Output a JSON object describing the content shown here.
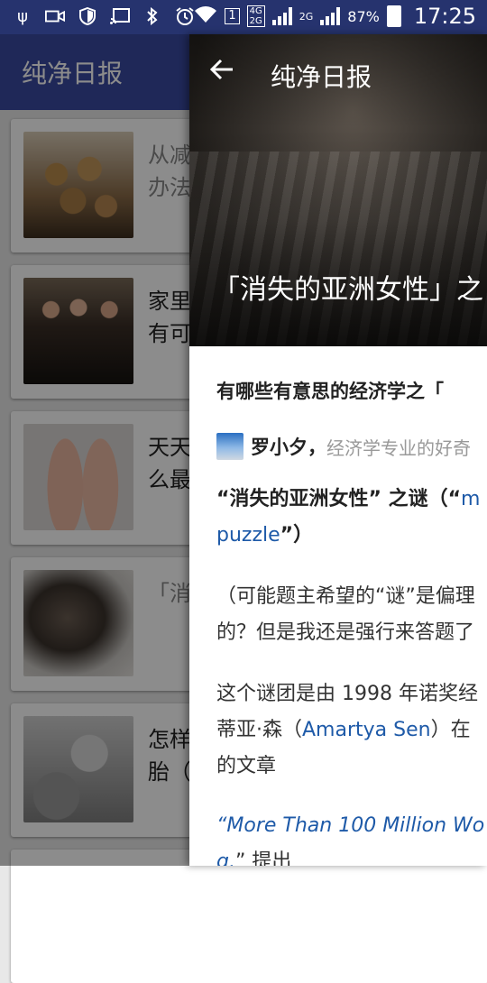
{
  "status_bar": {
    "sim_label": "1",
    "net_4g": "4G",
    "net_2g_a": "2G",
    "net_2g_b": "2G",
    "battery": "87%",
    "time": "17:25"
  },
  "app": {
    "title": "纯净日报"
  },
  "list": {
    "items": [
      {
        "title": "从减\n办法",
        "read": true
      },
      {
        "title": "家里\n有可",
        "read": false
      },
      {
        "title": "天天\n么最",
        "read": false
      },
      {
        "title": "「消",
        "read": true
      },
      {
        "title": "怎样\n胎（",
        "read": false
      }
    ]
  },
  "detail": {
    "toolbar_title": "纯净日报",
    "hero_title": "「消失的亚洲女性」之",
    "question_title": "有哪些有意思的经济学之「",
    "author_name": "罗小夕，",
    "author_bio": "经济学专业的好奇",
    "p1_bold": "“消失的亚洲女性” 之谜（“",
    "p1_link1": "m",
    "p1_link2": "puzzle",
    "p1_end": "”）",
    "p2_line1": "（可能题主希望的“谜”是偏理",
    "p2_line2": "的？但是我还是强行来答题了",
    "p3_line1": "这个谜团是由 1998 年诺奖经",
    "p3_line2a": "蒂亚·森（",
    "p3_link": "Amartya Sen",
    "p3_line2b": "）在",
    "p3_line3": "的文章",
    "p4_link": "“More Than 100 Million Wo",
    "p4_line2a": "g.",
    "p4_line2b": "” 提出"
  }
}
